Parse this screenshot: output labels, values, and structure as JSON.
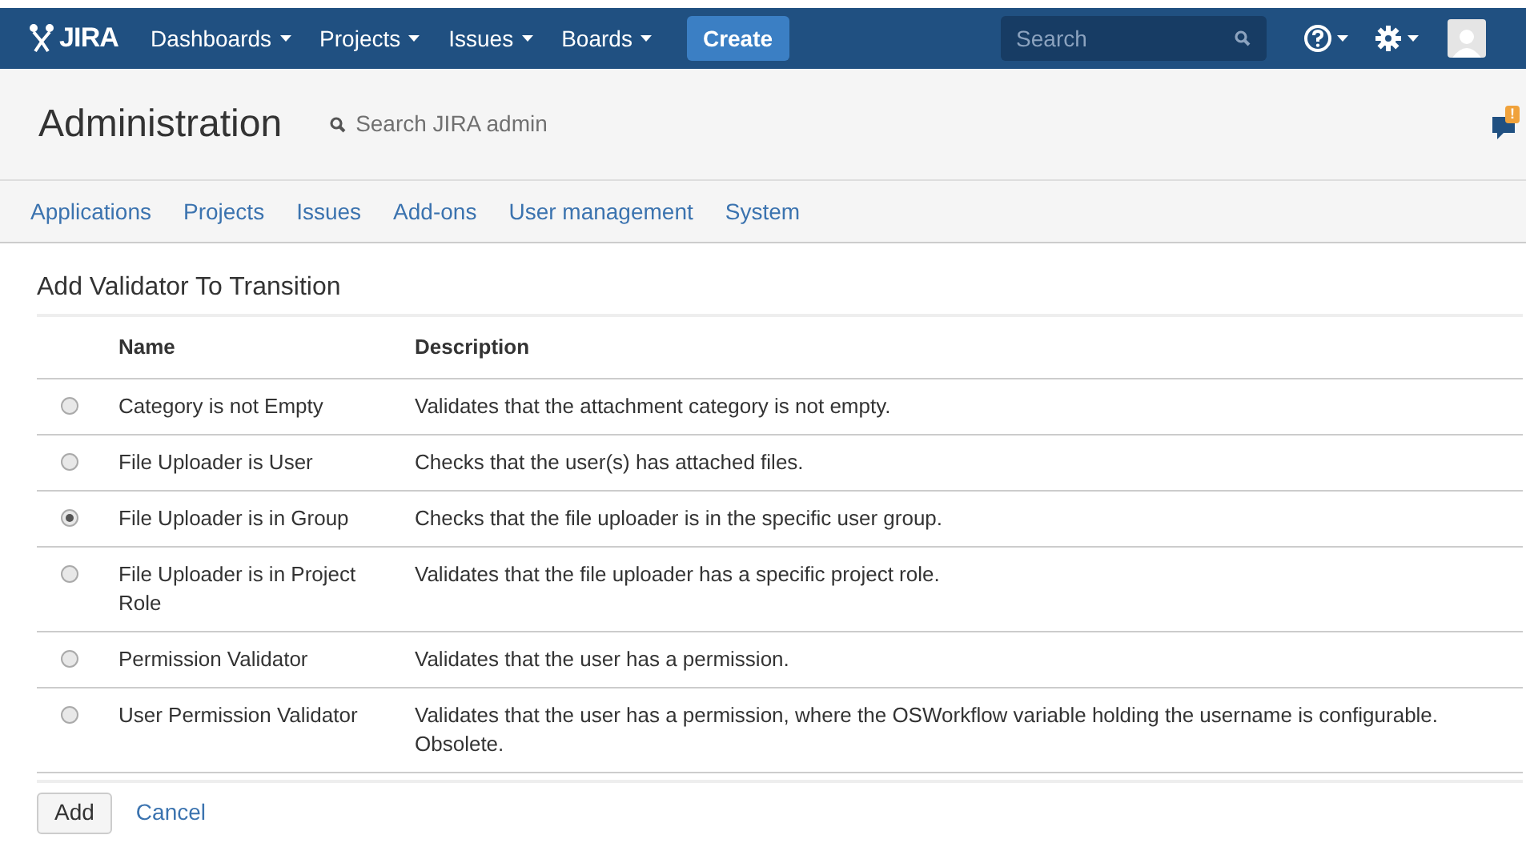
{
  "nav": {
    "logo": "JIRA",
    "menus": [
      {
        "label": "Dashboards"
      },
      {
        "label": "Projects"
      },
      {
        "label": "Issues"
      },
      {
        "label": "Boards"
      }
    ],
    "create": "Create",
    "search": {
      "placeholder": "Search"
    }
  },
  "admin": {
    "title": "Administration",
    "search": "Search JIRA admin",
    "notification_count": "!"
  },
  "tabs": [
    {
      "label": "Applications",
      "selected": false
    },
    {
      "label": "Projects",
      "selected": false
    },
    {
      "label": "Issues",
      "selected": false
    },
    {
      "label": "Add-ons",
      "selected": false
    },
    {
      "label": "User management",
      "selected": false
    },
    {
      "label": "System",
      "selected": false
    }
  ],
  "form": {
    "title": "Add Validator To Transition",
    "columns": [
      "Name",
      "Description"
    ],
    "rows": [
      {
        "name": "Category is not Empty",
        "description": "Validates that the attachment category is not empty.",
        "selected": false
      },
      {
        "name": "File Uploader is User",
        "description": "Checks that the user(s) has attached files.",
        "selected": false
      },
      {
        "name": "File Uploader is in Group",
        "description": "Checks that the file uploader is in the specific user group.",
        "selected": true
      },
      {
        "name": "File Uploader is in Project Role",
        "description": "Validates that the file uploader has a specific project role.",
        "selected": false
      },
      {
        "name": "Permission Validator",
        "description": "Validates that the user has a permission.",
        "selected": false
      },
      {
        "name": "User Permission Validator",
        "description": "Validates that the user has a permission, where the OSWorkflow variable holding the username is configurable. Obsolete.",
        "selected": false
      }
    ],
    "buttons": [
      {
        "label": "Add",
        "kind": "button"
      },
      {
        "label": "Cancel",
        "kind": "link"
      }
    ]
  }
}
